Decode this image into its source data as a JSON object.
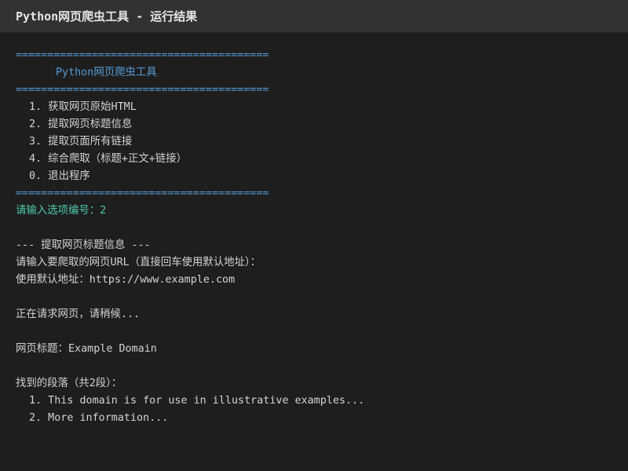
{
  "window": {
    "title": "Python网页爬虫工具 - 运行结果"
  },
  "terminal": {
    "separator": "========================================",
    "header": "Python网页爬虫工具",
    "menu": [
      "1. 获取网页原始HTML",
      "2. 提取网页标题信息",
      "3. 提取页面所有链接",
      "4. 综合爬取（标题+正文+链接）",
      "0. 退出程序"
    ],
    "choice_prompt": "请输入选项编号：2",
    "section_title": "--- 提取网页标题信息 ---",
    "url_prompt": "请输入要爬取的网页URL（直接回车使用默认地址）：",
    "url_value": "使用默认地址：https://www.example.com",
    "status": "正在请求网页，请稍候...",
    "page_title": "网页标题：Example Domain",
    "paragraph_header": "找到的段落（共2段）：",
    "paragraphs": [
      "1. This domain is for use in illustrative examples...",
      "2. More information..."
    ]
  },
  "colors": {
    "background": "#1e1e1e",
    "titlebar": "#323232",
    "separator": "#569cd6",
    "prompt": "#4ec9b0",
    "text": "#d4d4d4"
  }
}
